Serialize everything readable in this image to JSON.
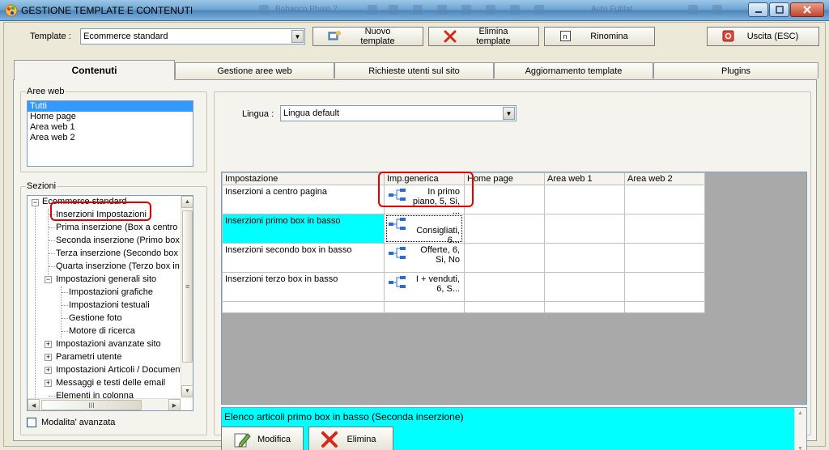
{
  "window": {
    "title": "GESTIONE TEMPLATE E CONTENUTI",
    "ghost_labels": [
      "Bohanco Photo ?",
      "Auto Fublat"
    ]
  },
  "toolbar": {
    "template_label": "Template :",
    "template_value": "Ecommerce standard",
    "new_template": "Nuovo template",
    "delete_template": "Elimina template",
    "rename": "Rinomina",
    "exit": "Uscita (ESC)"
  },
  "tabs": [
    "Contenuti",
    "Gestione aree web",
    "Richieste utenti sul sito",
    "Aggiornamento template",
    "Plugins"
  ],
  "aree_web": {
    "title": "Aree web",
    "items": [
      "Tutti",
      "Home page",
      "Area web 1",
      "Area web 2"
    ],
    "selected": "Tutti"
  },
  "sezioni": {
    "title": "Sezioni",
    "root": "Ecommerce standard",
    "items": [
      "Inserzioni Impostazioni",
      "Prima inserzione (Box a centro pa",
      "Seconda inserzione (Primo box in",
      "Terza inserzione (Secondo box in",
      "Quarta inserzione (Terzo box in b",
      "Impostazioni generali sito",
      "Impostazioni grafiche",
      "Impostazioni testuali",
      "Gestione foto",
      "Motore di ricerca",
      "Impostazioni avanzate sito",
      "Parametri utente",
      "Impostazioni Articoli / Documenti",
      "Messaggi e testi delle email",
      "Elementi in colonna"
    ],
    "hscroll_glyph": "III",
    "vscroll_glyph": "≡"
  },
  "advanced_mode": "Modalita' avanzata",
  "lingua": {
    "label": "Lingua :",
    "value": "Lingua default"
  },
  "grid": {
    "columns": [
      "Impostazione",
      "Imp.generica",
      "Home page",
      "Area web 1",
      "Area web 2"
    ],
    "rows": [
      {
        "name": "Inserzioni a centro pagina",
        "generic": "In primo piano, 5, Si, ..."
      },
      {
        "name": "Inserzioni primo box in basso",
        "generic": "Consigliati, 6..."
      },
      {
        "name": "Inserzioni secondo box in basso",
        "generic": "Offerte, 6, Si, No"
      },
      {
        "name": "Inserzioni terzo box in basso",
        "generic": "I + venduti, 6, S..."
      }
    ],
    "selected_row_index": 1
  },
  "memo_text": "Elenco articoli primo box in basso (Seconda inserzione)",
  "buttons": {
    "modifica": "Modifica",
    "elimina": "Elimina"
  },
  "colors": {
    "selection_cyan": "#00ffff",
    "list_selection": "#3399ff",
    "highlight_red": "#e00000"
  }
}
